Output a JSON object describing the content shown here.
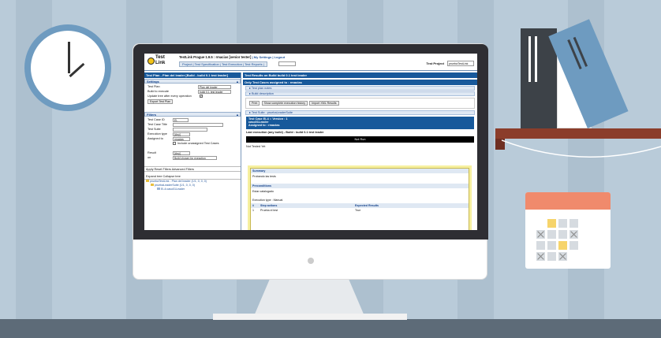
{
  "app": {
    "logo_text": "Test Link",
    "title": "TestLink Prague 1.9.5 : rmacias [senior tester]",
    "header_links": "| My Settings | Logout",
    "nav": "Project | Test Specification | Test Execution | Test Reports | ",
    "nav_search_placeholder": "",
    "project_label": "Test Project",
    "project_value": "pruebaTestLink"
  },
  "left": {
    "plan_bar": "Test Plan - Plan del leader [Build - build 0.1 test leader]",
    "settings_title": "Settings",
    "test_plan_label": "Test Plan",
    "test_plan_value": "Plan del leader",
    "build_label": "Build to execute",
    "build_value": "build 0.1 test leader",
    "update_label": "Update tree after every operation",
    "export_btn": "Export Test Plan",
    "filters_title": "Filters",
    "tc_id_label": "Test Case ID",
    "tc_id_value": "El-",
    "tc_title_label": "Test Case Title",
    "suite_label": "Test Suite",
    "exec_type_label": "Execution type",
    "exec_type_value": "[Any]",
    "assigned_label": "Assigned to",
    "assigned_value": "rmacias",
    "unassigned_label": "Include unassigned Test Cases",
    "result_label": "Result",
    "result_value": "[Any]",
    "on_label": "on",
    "on_value": "Build chosen for execution",
    "filter_buttons": "Apply  Reset Filters  Advanced Filters",
    "tree_buttons": "Expand tree  Collapse tree",
    "tree": [
      "pruebaTestLink - Plan del leader (1/1, 0, 0, 0)",
      "pruebaLeaderSuite (1/1, 0, 0, 0)",
      "El-4:caso01Leader"
    ]
  },
  "right": {
    "results_bar": "Test Results on Build build 0.1 test leader",
    "assigned_bar": "Only Test Cases assigned to : rmacias",
    "notes_section": "Test plan notes",
    "build_section": "Build description",
    "buttons": [
      "Print",
      "Show complete execution history",
      "Import XML Results"
    ],
    "suite_section": "Test Suite : pruebaLeaderSuite",
    "tc_line1": "Test Case El-4 :: Version : 1",
    "tc_line2": "caso01Leader",
    "tc_line3": "Assigned to : rmacias",
    "last_exec": "Last execution (any build) - Build : build 0.1 test leader",
    "status": "Not Run",
    "not_tested": "Not Tested Yet",
    "summary_title": "Summary",
    "summary_text": "Probando las tests",
    "precond_title": "Preconditions",
    "precond_text": "Estar catalogado",
    "exec_type_text": "Execution type : Manual",
    "step_header": [
      "#",
      "Step actions",
      "Expected Results"
    ],
    "step_row": [
      "1",
      "Prueba el test",
      "True"
    ]
  },
  "colors": {
    "accent": "#17599b",
    "shelf": "#8b3d2b",
    "calendar": "#f08a6c"
  }
}
